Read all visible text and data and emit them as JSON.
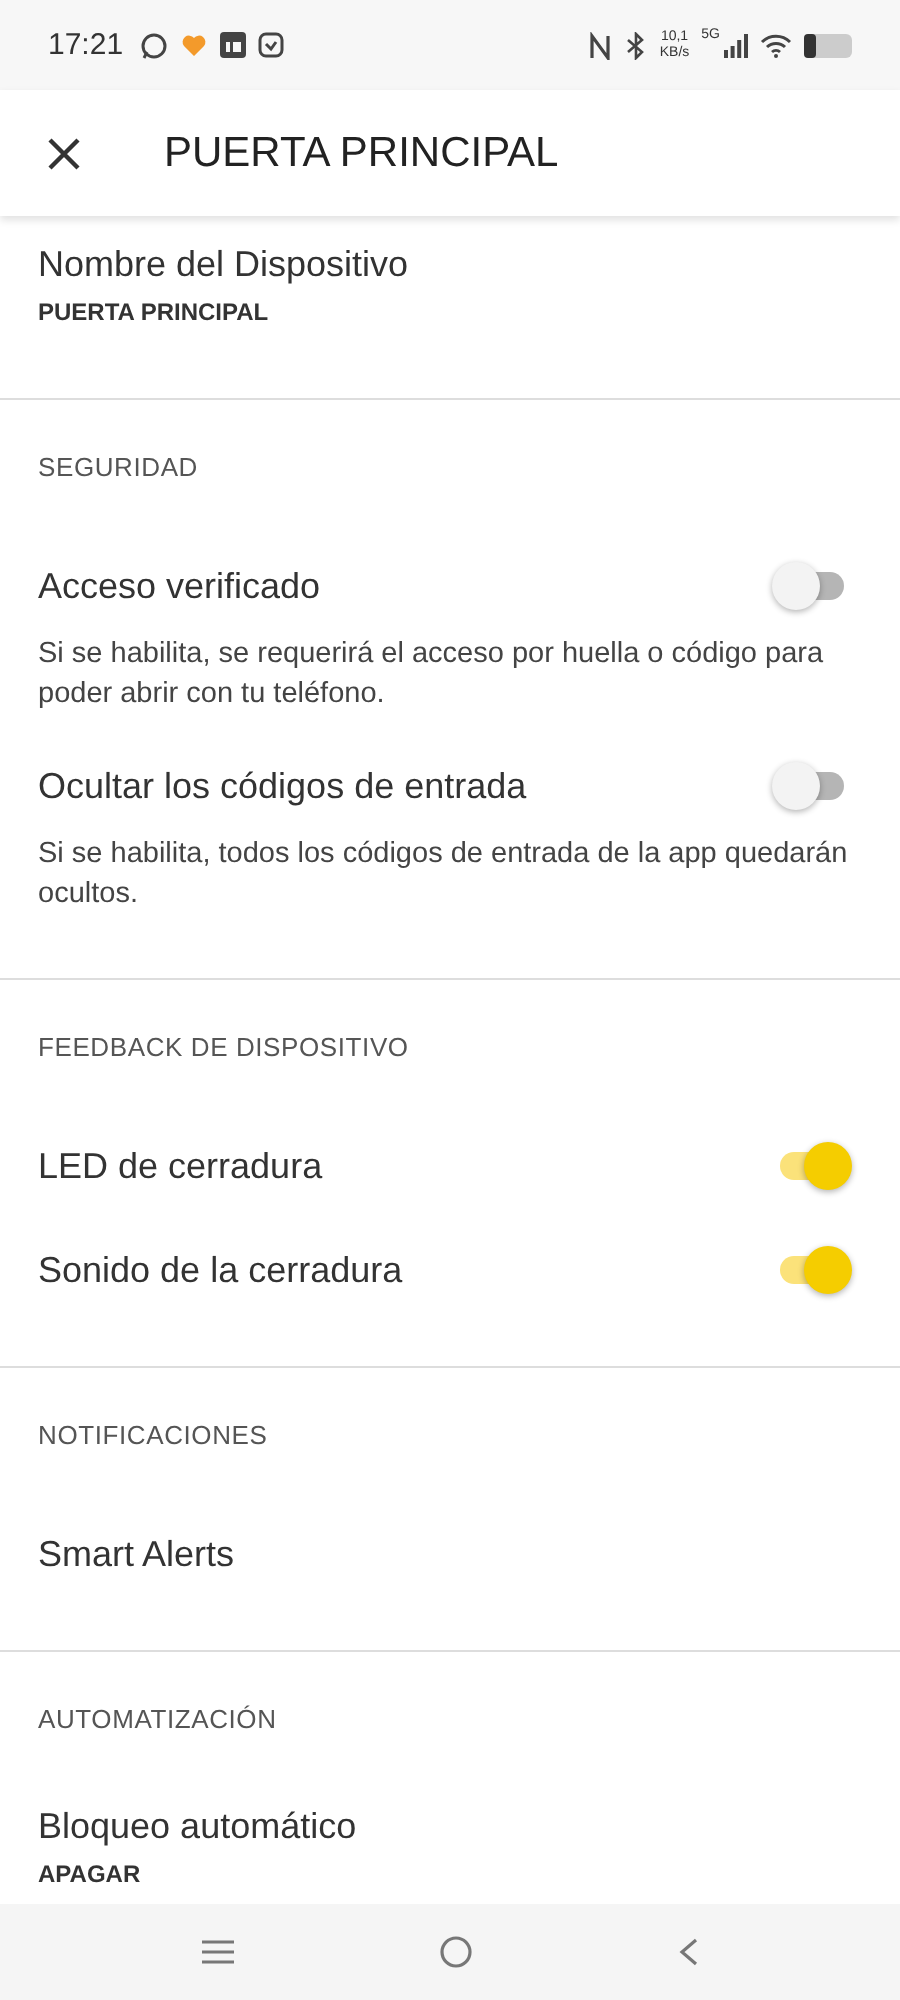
{
  "status_bar": {
    "time": "17:21",
    "speed": "10,1",
    "speed_unit": "KB/s",
    "network": "5G"
  },
  "header": {
    "title": "PUERTA PRINCIPAL"
  },
  "sections": [
    {
      "items": [
        {
          "kind": "value",
          "label": "Nombre del Dispositivo",
          "value": "PUERTA PRINCIPAL"
        }
      ]
    },
    {
      "title": "SEGURIDAD",
      "items": [
        {
          "kind": "toggle",
          "label": "Acceso verificado",
          "on": false,
          "description": "Si se habilita, se requerirá el acceso por huella o código para poder abrir con tu teléfono."
        },
        {
          "kind": "toggle",
          "label": "Ocultar los códigos de entrada",
          "on": false,
          "description": "Si se habilita, todos los códigos de entrada de la app quedarán ocultos."
        }
      ]
    },
    {
      "title": "FEEDBACK DE DISPOSITIVO",
      "items": [
        {
          "kind": "toggle",
          "label": "LED de cerradura",
          "on": true
        },
        {
          "kind": "toggle",
          "label": "Sonido de la cerradura",
          "on": true
        }
      ]
    },
    {
      "title": "NOTIFICACIONES",
      "items": [
        {
          "kind": "link",
          "label": "Smart Alerts"
        }
      ]
    },
    {
      "title": "AUTOMATIZACIÓN",
      "items": [
        {
          "kind": "value",
          "label": "Bloqueo automático",
          "value": "APAGAR"
        }
      ]
    }
  ]
}
